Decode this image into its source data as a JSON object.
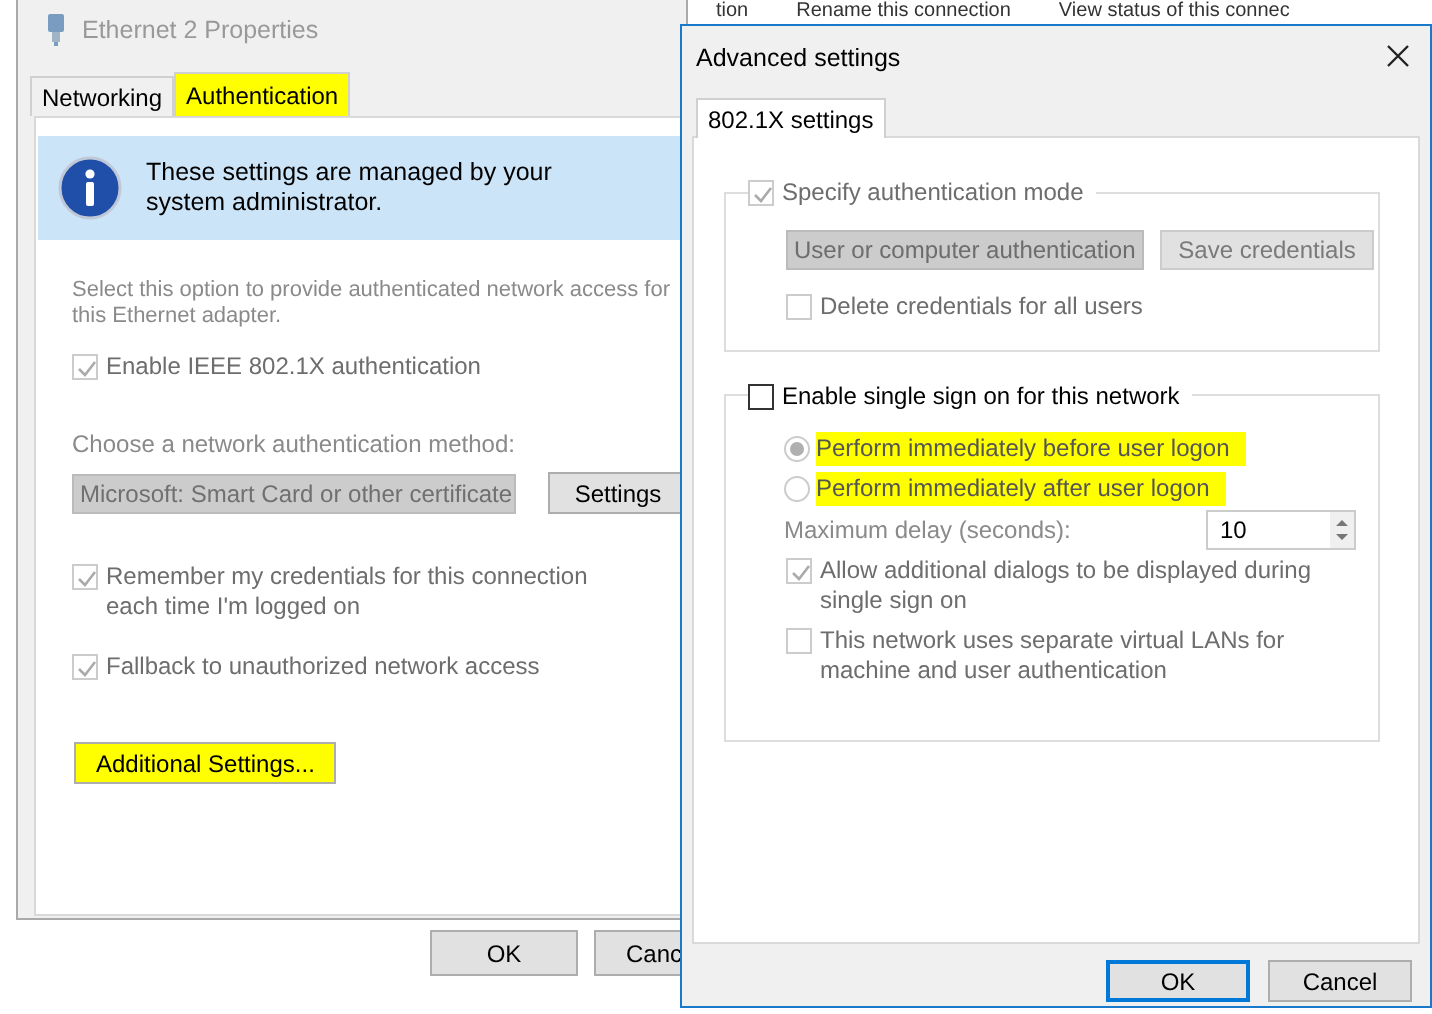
{
  "background_links": [
    "tion",
    "Rename this connection",
    "View status of this connec"
  ],
  "properties_window": {
    "title": "Ethernet 2 Properties",
    "tabs": [
      {
        "label": "Networking",
        "selected": false,
        "highlighted": false
      },
      {
        "label": "Authentication",
        "selected": true,
        "highlighted": true
      }
    ],
    "banner": "These settings are managed by your system administrator.",
    "description": "Select this option to provide authenticated network access for this Ethernet adapter.",
    "enable_option": {
      "label": "Enable IEEE 802.1X authentication",
      "checked": true,
      "disabled": true
    },
    "method_label": "Choose a network authentication method:",
    "method_combo": {
      "value": "Microsoft: Smart Card or other certificate",
      "disabled": true
    },
    "settings_button": "Settings",
    "options": [
      {
        "label": "Remember my credentials for this connection each time I'm logged on",
        "checked": true,
        "disabled": true
      },
      {
        "label": "Fallback to unauthorized network access",
        "checked": true,
        "disabled": true
      }
    ],
    "additional_button": {
      "label": "Additional Settings...",
      "highlighted": true
    },
    "buttons": [
      "OK",
      "Canc"
    ]
  },
  "advanced_window": {
    "title": "Advanced settings",
    "tabs": [
      {
        "label": "802.1X settings",
        "selected": true
      }
    ],
    "auth_mode": {
      "label": "Specify authentication mode",
      "checked": true,
      "disabled": true
    },
    "auth_combo": {
      "value": "User or computer authentication",
      "disabled": true
    },
    "save_button": {
      "label": "Save credentials",
      "disabled": true
    },
    "delete_credentials": {
      "label": "Delete credentials for all users",
      "checked": false,
      "disabled": true
    },
    "sso": {
      "label": "Enable single sign on for this network",
      "checked": false,
      "disabled": false
    },
    "radios": [
      {
        "label": "Perform immediately before user logon",
        "selected": true,
        "highlighted": true
      },
      {
        "label": "Perform immediately after user logon",
        "selected": false,
        "highlighted": true
      }
    ],
    "delay_label": "Maximum delay (seconds):",
    "delay_value": "10",
    "sso_options": [
      {
        "label": "Allow additional dialogs to be displayed during single sign on",
        "checked": true,
        "disabled": true
      },
      {
        "label": "This network uses separate virtual LANs for machine and user authentication",
        "checked": false,
        "disabled": true
      }
    ],
    "buttons": [
      {
        "label": "OK",
        "default": true
      },
      {
        "label": "Cancel",
        "default": false
      }
    ]
  }
}
